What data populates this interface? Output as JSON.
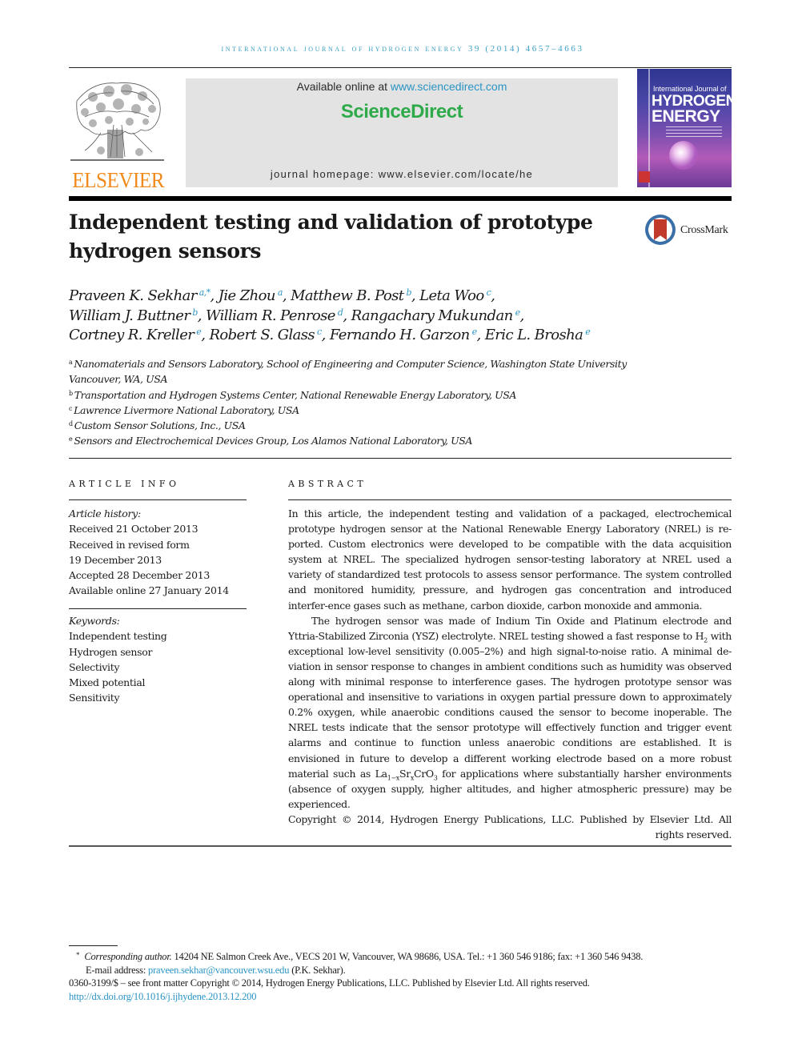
{
  "running_head": "International Journal of Hydrogen Energy",
  "running_head_numbers": "39 (2014) 4657–4663",
  "header": {
    "publisher_logo_text": "ELSEVIER",
    "available_online_prefix": "Available online at",
    "available_online_link": "www.sciencedirect.com",
    "sciencedirect_logo": "ScienceDirect",
    "journal_homepage": "journal homepage: www.elsevier.com/locate/he",
    "cover": {
      "line1": "International Journal of",
      "line2": "HYDROGEN",
      "line3": "ENERGY"
    }
  },
  "title": "Independent testing and validation of prototype hydrogen sensors",
  "crossmark_label": "CrossMark",
  "authors": [
    {
      "name": "Praveen K. Sekhar",
      "sup": "a,*",
      "sep": ", "
    },
    {
      "name": "Jie Zhou",
      "sup": "a",
      "sep": ", "
    },
    {
      "name": "Matthew B. Post",
      "sup": "b",
      "sep": ", "
    },
    {
      "name": "Leta Woo",
      "sup": "c",
      "sep": ","
    },
    {
      "name": "William J. Buttner",
      "sup": "b",
      "sep": ", "
    },
    {
      "name": "William R. Penrose",
      "sup": "d",
      "sep": ", "
    },
    {
      "name": "Rangachary Mukundan",
      "sup": "e",
      "sep": ","
    },
    {
      "name": "Cortney R. Kreller",
      "sup": "e",
      "sep": ", "
    },
    {
      "name": "Robert S. Glass",
      "sup": "c",
      "sep": ", "
    },
    {
      "name": "Fernando H. Garzon",
      "sup": "e",
      "sep": ", "
    },
    {
      "name": "Eric L. Brosha",
      "sup": "e",
      "sep": ""
    }
  ],
  "affiliations": [
    {
      "key": "a",
      "text": "Nanomaterials and Sensors Laboratory, School of Engineering and Computer Science, Washington State University Vancouver, WA, USA"
    },
    {
      "key": "b",
      "text": "Transportation and Hydrogen Systems Center, National Renewable Energy Laboratory, USA"
    },
    {
      "key": "c",
      "text": "Lawrence Livermore National Laboratory, USA"
    },
    {
      "key": "d",
      "text": "Custom Sensor Solutions, Inc., USA"
    },
    {
      "key": "e",
      "text": "Sensors and Electrochemical Devices Group, Los Alamos National Laboratory, USA"
    }
  ],
  "article_info": {
    "heading": "ARTICLE INFO",
    "history_label": "Article history:",
    "history": [
      "Received 21 October 2013",
      "Received in revised form",
      "19 December 2013",
      "Accepted 28 December 2013",
      "Available online 27 January 2014"
    ],
    "keywords_label": "Keywords:",
    "keywords": [
      "Independent testing",
      "Hydrogen sensor",
      "Selectivity",
      "Mixed potential",
      "Sensitivity"
    ]
  },
  "abstract": {
    "heading": "ABSTRACT",
    "p1": "In this article, the independent testing and validation of a packaged, electrochemical prototype hydrogen sensor at the National Renewable Energy Laboratory (NREL) is re-ported. Custom electronics were developed to be compatible with the data acquisition system at NREL. The specialized hydrogen sensor-testing laboratory at NREL used a variety of standardized test protocols to assess sensor performance. The system controlled and monitored humidity, pressure, and hydrogen gas concentration and introduced interfer-ence gases such as methane, carbon dioxide, carbon monoxide and ammonia.",
    "p2_a": "The hydrogen sensor was made of Indium Tin Oxide and Platinum electrode and Yttria-Stabilized Zirconia (YSZ) electrolyte. NREL testing showed a fast response to H",
    "p2_sub1": "2",
    "p2_b": " with exceptional low-level sensitivity (0.005–2%) and high signal-to-noise ratio. A minimal de-viation in sensor response to changes in ambient conditions such as humidity was observed along with minimal response to interference gases. The hydrogen prototype sensor was operational and insensitive to variations in oxygen partial pressure down to approximately 0.2% oxygen, while anaerobic conditions caused the sensor to become inoperable. The NREL tests indicate that the sensor prototype will effectively function and trigger event alarms and continue to function unless anaerobic conditions are established. It is envisioned in future to develop a different working electrode based on a more robust material such as La",
    "p2_sub2": "1−x",
    "p2_c": "Sr",
    "p2_sub3": "x",
    "p2_d": "CrO",
    "p2_sub4": "3",
    "p2_e": " for applications where substantially harsher environments (absence of oxygen supply, higher altitudes, and higher atmospheric pressure) may be experienced.",
    "copyright": "Copyright © 2014, Hydrogen Energy Publications, LLC. Published by Elsevier Ltd. All rights reserved."
  },
  "footnotes": {
    "star": "*",
    "corresponding_label": "Corresponding author.",
    "corresponding_text": " 14204 NE Salmon Creek Ave., VECS 201 W, Vancouver, WA 98686, USA. Tel.: +1 360 546 9186; fax: +1 360 546 9438.",
    "email_label": "E-mail address: ",
    "email": "praveen.sekhar@vancouver.wsu.edu",
    "email_suffix": " (P.K. Sekhar).",
    "issn_line": "0360-3199/$ – see front matter Copyright © 2014, Hydrogen Energy Publications, LLC. Published by Elsevier Ltd. All rights reserved.",
    "doi": "http://dx.doi.org/10.1016/j.ijhydene.2013.12.200"
  },
  "colors": {
    "link": "#2a94c4",
    "elsevier_orange": "#f08a1c",
    "sciencedirect_green": "#2faa4a",
    "header_box": "#e3e3e3"
  }
}
